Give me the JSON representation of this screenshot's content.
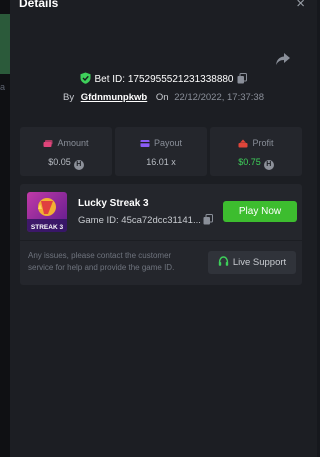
{
  "header": {
    "title": "Details",
    "close_label": "×"
  },
  "bet": {
    "id_label": "Bet ID: 1752955521231338880",
    "by_prefix": "By",
    "username": "Gfdnmunpkwb",
    "on_prefix": "On",
    "datetime": "22/12/2022, 17:37:38"
  },
  "stats": {
    "amount": {
      "label": "Amount",
      "value": "$0.05",
      "currency_badge": "H"
    },
    "payout": {
      "label": "Payout",
      "value": "16.01 x"
    },
    "profit": {
      "label": "Profit",
      "value": "$0.75",
      "currency_badge": "H"
    }
  },
  "game": {
    "name": "Lucky Streak 3",
    "id_text": "Game ID: 45ca72dcc31141...",
    "thumb_label": "STREAK 3",
    "play_label": "Play Now"
  },
  "support": {
    "notice": "Any issues, please contact the customer service for help and provide the game ID.",
    "button_label": "Live Support"
  },
  "colors": {
    "accent_green": "#3dbd2f",
    "profit_green": "#3ed05a",
    "amount_icon": "#e0457b",
    "payout_icon": "#8b5cf6",
    "profit_icon": "#e0453a"
  },
  "icons": [
    "shield-check-icon",
    "copy-icon",
    "share-icon",
    "close-icon",
    "cash-icon",
    "payout-icon",
    "profit-icon",
    "headset-icon",
    "coin-icon"
  ]
}
